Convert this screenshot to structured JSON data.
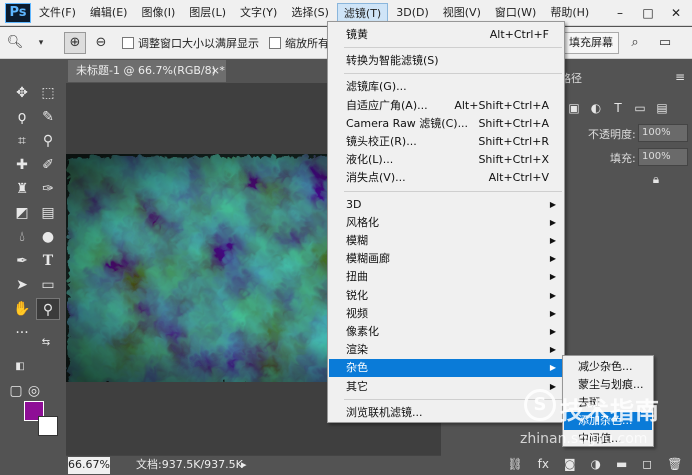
{
  "menubar": {
    "logo": "Ps",
    "items": [
      "文件(F)",
      "编辑(E)",
      "图像(I)",
      "图层(L)",
      "文字(Y)",
      "选择(S)",
      "滤镜(T)",
      "3D(D)",
      "视图(V)",
      "窗口(W)",
      "帮助(H)"
    ],
    "active_index": 6,
    "window_buttons": [
      "–",
      "□",
      "✕"
    ]
  },
  "options": {
    "tool_icon": "magnifier-icon",
    "checkbox1_label": "调整窗口大小以满屏显示",
    "checkbox2_label": "缩放所有",
    "fill_screen_button": "填充屏幕"
  },
  "document": {
    "tab_title": "未标题-1 @ 66.7%(RGB/8) *",
    "zoom": "66.67%",
    "doc_size": "文档:937.5K/937.5K"
  },
  "colors": {
    "foreground": "#8e0e96",
    "background": "#ffffff",
    "menu_highlight": "#0a7bd8"
  },
  "panel": {
    "tab_label": "路径",
    "opacity_label": "不透明度:",
    "opacity_value": "100%",
    "fill_label": "填充:",
    "fill_value": "100%"
  },
  "filter_menu": {
    "items": [
      {
        "label": "锐化",
        "top": 0
      },
      {
        "label": "镜黄",
        "shortcut": "Alt+Ctrl+F"
      },
      {
        "sep": true
      },
      {
        "label": "转换为智能滤镜(S)"
      },
      {
        "sep": true
      },
      {
        "label": "滤镜库(G)..."
      },
      {
        "label": "自适应广角(A)...",
        "shortcut": "Alt+Shift+Ctrl+A"
      },
      {
        "label": "Camera Raw 滤镜(C)...",
        "shortcut": "Shift+Ctrl+A"
      },
      {
        "label": "镜头校正(R)...",
        "shortcut": "Shift+Ctrl+R"
      },
      {
        "label": "液化(L)...",
        "shortcut": "Shift+Ctrl+X"
      },
      {
        "label": "消失点(V)...",
        "shortcut": "Alt+Ctrl+V"
      },
      {
        "sep": true
      },
      {
        "label": "3D",
        "submenu": true
      },
      {
        "label": "风格化",
        "submenu": true
      },
      {
        "label": "模糊",
        "submenu": true
      },
      {
        "label": "模糊画廊",
        "submenu": true
      },
      {
        "label": "扭曲",
        "submenu": true
      },
      {
        "label": "锐化",
        "submenu": true
      },
      {
        "label": "视频",
        "submenu": true
      },
      {
        "label": "像素化",
        "submenu": true
      },
      {
        "label": "渲染",
        "submenu": true
      },
      {
        "label": "杂色",
        "submenu": true,
        "highlighted": true
      },
      {
        "label": "其它",
        "submenu": true
      },
      {
        "sep": true
      },
      {
        "label": "浏览联机滤镜..."
      }
    ]
  },
  "noise_menu": {
    "items": [
      {
        "label": "减少杂色..."
      },
      {
        "label": "蒙尘与划痕..."
      },
      {
        "label": "去斑"
      },
      {
        "label": "添加杂色...",
        "highlighted": true
      },
      {
        "label": "中间值..."
      }
    ]
  },
  "watermark": {
    "logo": "S",
    "text": "技术指南",
    "url": "zhinan.sogou.com"
  }
}
